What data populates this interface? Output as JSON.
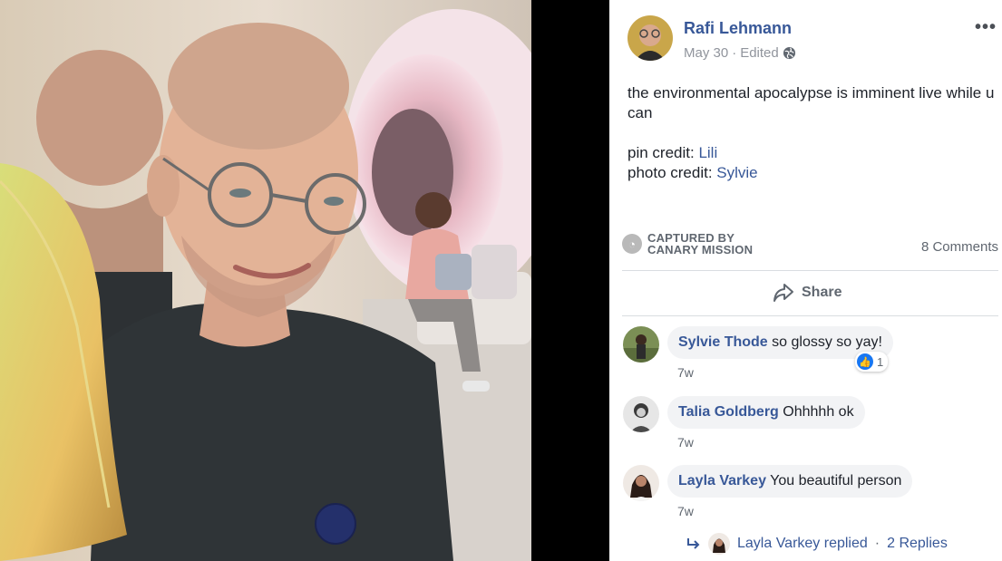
{
  "post": {
    "author": "Rafi Lehmann",
    "date": "May 30",
    "edited": "Edited",
    "separator": "·",
    "more": "•••",
    "text_line1": "the environmental apocalypse is imminent live while u can",
    "pin_label": "pin credit: ",
    "pin_name": "Lili",
    "photo_label": "photo credit: ",
    "photo_name": "Sylvie",
    "captured_line1": "CAPTURED BY",
    "captured_line2": "CANARY MISSION",
    "comments_count": "8 Comments",
    "share_label": "Share"
  },
  "comments": [
    {
      "name": "Sylvie Thode",
      "text": "so glossy so yay!",
      "time": "7w",
      "reactions": "1"
    },
    {
      "name": "Talia Goldberg",
      "text": "Ohhhhh ok",
      "time": "7w"
    },
    {
      "name": "Layla Varkey",
      "text": "You beautiful person",
      "time": "7w"
    }
  ],
  "reply_summary": {
    "text": "Layla Varkey replied",
    "dot": "·",
    "count": "2 Replies"
  },
  "colors": {
    "link": "#385898",
    "muted": "#606770",
    "bubble": "#f2f3f5",
    "like": "#1877f2"
  }
}
